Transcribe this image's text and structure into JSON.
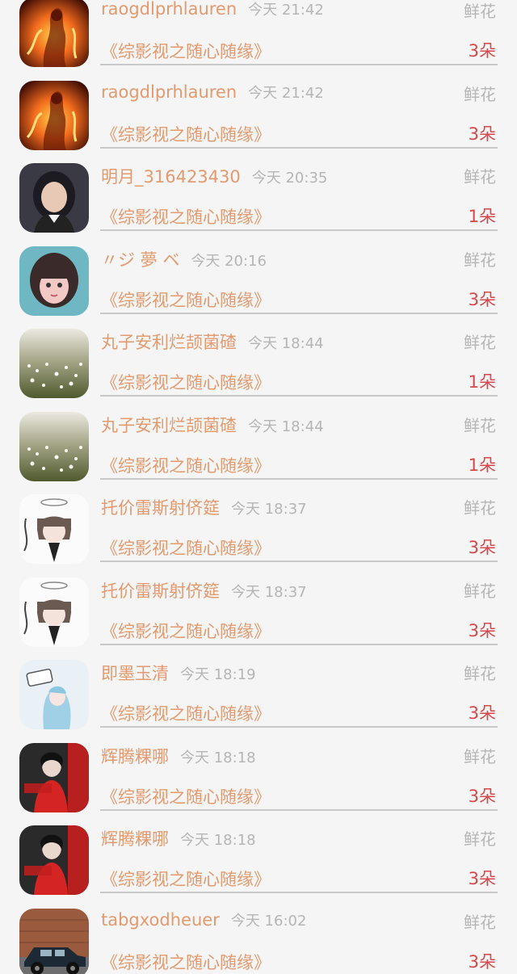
{
  "items": [
    {
      "user": "raogdlprhlauren",
      "time": "今天 21:42",
      "gift": "鲜花",
      "book": "《综影视之随心随缘》",
      "count": "3朵",
      "avatar": "fire-figure"
    },
    {
      "user": "raogdlprhlauren",
      "time": "今天 21:42",
      "gift": "鲜花",
      "book": "《综影视之随心随缘》",
      "count": "3朵",
      "avatar": "fire-figure"
    },
    {
      "user": "明月_316423430",
      "time": "今天 20:35",
      "gift": "鲜花",
      "book": "《综影视之随心随缘》",
      "count": "1朵",
      "avatar": "girl-dark-hair"
    },
    {
      "user": "〃ジ 夢 ベ",
      "time": "今天 20:16",
      "gift": "鲜花",
      "book": "《综影视之随心随缘》",
      "count": "3朵",
      "avatar": "girl-bangs"
    },
    {
      "user": "丸子安利烂颉菌碴",
      "time": "今天 18:44",
      "gift": "鲜花",
      "book": "《综影视之随心随缘》",
      "count": "1朵",
      "avatar": "flower-field"
    },
    {
      "user": "丸子安利烂颉菌碴",
      "time": "今天 18:44",
      "gift": "鲜花",
      "book": "《综影视之随心随缘》",
      "count": "1朵",
      "avatar": "flower-field"
    },
    {
      "user": "托价雷斯射侪筵",
      "time": "今天 18:37",
      "gift": "鲜花",
      "book": "《综影视之随心随缘》",
      "count": "3朵",
      "avatar": "anime-halo"
    },
    {
      "user": "托价雷斯射侪筵",
      "time": "今天 18:37",
      "gift": "鲜花",
      "book": "《综影视之随心随缘》",
      "count": "3朵",
      "avatar": "anime-halo"
    },
    {
      "user": "即墨玉清",
      "time": "今天 18:19",
      "gift": "鲜花",
      "book": "《综影视之随心随缘》",
      "count": "3朵",
      "avatar": "anime-blue-hair"
    },
    {
      "user": "辉腾粿哪",
      "time": "今天 18:18",
      "gift": "鲜花",
      "book": "《综影视之随心随缘》",
      "count": "3朵",
      "avatar": "woman-red-dress"
    },
    {
      "user": "辉腾粿哪",
      "time": "今天 18:18",
      "gift": "鲜花",
      "book": "《综影视之随心随缘》",
      "count": "3朵",
      "avatar": "woman-red-dress"
    },
    {
      "user": "tabgxodheuer",
      "time": "今天 16:02",
      "gift": "鲜花",
      "book": "《综影视之随心随缘》",
      "count": "3朵",
      "avatar": "vintage-car"
    }
  ],
  "colors": {
    "name": "#e39a6f",
    "time": "#b5b5b5",
    "count": "#d8474a",
    "background": "#f5f5f5"
  }
}
